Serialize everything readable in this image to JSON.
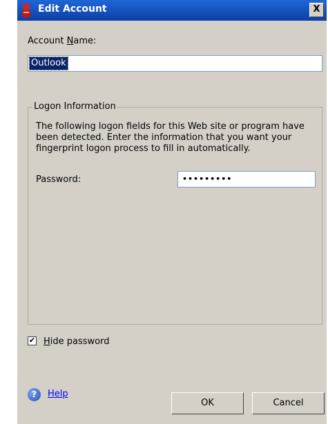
{
  "window": {
    "title": "Edit Account",
    "close_label": "X"
  },
  "account_name": {
    "label_pre": "Account ",
    "label_key": "N",
    "label_post": "ame:",
    "value": "Outlook"
  },
  "logon": {
    "group_title": "Logon Information",
    "description": "The following logon fields for this Web site or program have been detected. Enter the information that you want your fingerprint logon process to fill in automatically.",
    "password_label": "Password:",
    "password_masked": "•••••••••"
  },
  "hide_password": {
    "checked_mark": "✔",
    "label_key": "H",
    "label_rest": "ide password"
  },
  "help": {
    "icon_glyph": "?",
    "label": "Help"
  },
  "buttons": {
    "ok": "OK",
    "cancel": "Cancel"
  }
}
